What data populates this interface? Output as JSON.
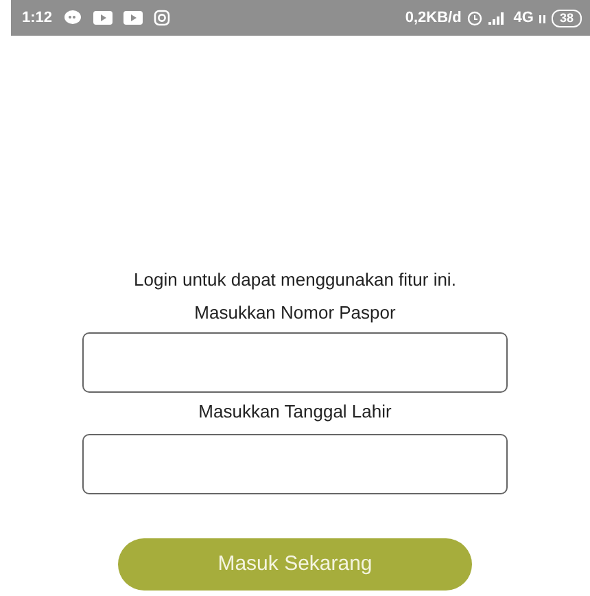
{
  "status_bar": {
    "time": "1:12",
    "data_rate": "0,2KB/d",
    "network": "4G",
    "battery": "38"
  },
  "prompt": "Login untuk dapat menggunakan fitur ini.",
  "fields": [
    {
      "label": "Masukkan Nomor Paspor"
    },
    {
      "label": "Masukkan Tanggal Lahir"
    }
  ],
  "submit_button": "Masuk Sekarang"
}
